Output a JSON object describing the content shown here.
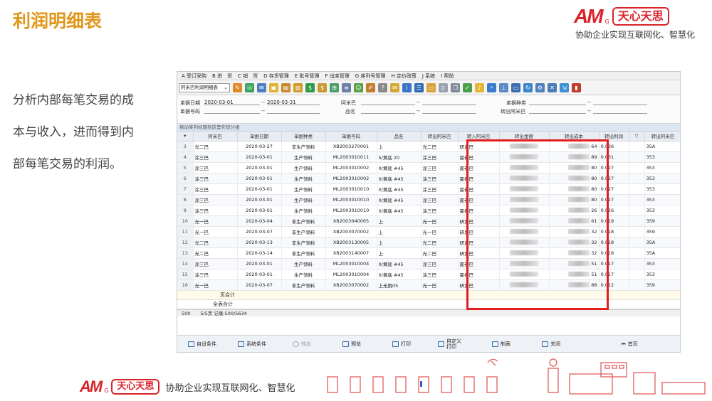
{
  "slide": {
    "title": "利润明细表",
    "description_lines": [
      "分析内部每笔交易的成",
      "本与收入，进而得到内",
      "部每笔交易的利润。"
    ]
  },
  "brand": {
    "logo_text": "AM",
    "logo_sub": "G",
    "name_box": "天心天思",
    "slogan": "协助企业实现互联网化、智慧化",
    "color": "#d8232a"
  },
  "app": {
    "menu": [
      "A 受订采购",
      "B 进　货",
      "C 销　货",
      "D 存货管理",
      "E 批号管理",
      "F 出库管理",
      "G 序列号管理",
      "H 定价政策",
      "J 系统",
      "I 帮助"
    ],
    "report_select": "阿米巴利润明细表",
    "filters": {
      "date_label": "单据日期",
      "date_from": "2020-03-01",
      "date_to": "2020-03-31",
      "amoeba_label": "阿米巴",
      "category_label": "单据种类",
      "doc_no_label": "单据号码",
      "name_label": "品名",
      "out_amoeba_label": "转出阿米巴",
      "range_sep": "--"
    },
    "group_hint": "拖动某列标题到这里实现分组",
    "columns": [
      "",
      "阿米巴",
      "单据日期",
      "单据种类",
      "单据号码",
      "品名",
      "转出阿米巴",
      "转入阿米巴",
      "转出金额",
      "转出成本",
      "转出利润",
      "",
      "转出阿米巴"
    ],
    "rows": [
      {
        "n": "3",
        "amoeba": "光二巴",
        "date": "2020-03-27",
        "kind": "非生产领料",
        "doc": "XB2003270001",
        "name": "上",
        "out": "光二巴",
        "in": "研发巴",
        "cost_tail": "64",
        "profit": "0.036",
        "tail": "35A"
      },
      {
        "n": "4",
        "amoeba": "涂三巴",
        "date": "2020-03-01",
        "kind": "生产领料",
        "doc": "ML2003010011",
        "name": "5/黄底 20",
        "out": "涂三巴",
        "in": "夏卷巴",
        "cost_tail": "89",
        "profit": "0.031",
        "tail": "353"
      },
      {
        "n": "5",
        "amoeba": "涂三巴",
        "date": "2020-03-01",
        "kind": "生产领料",
        "doc": "ML2003010002",
        "name": "0/黄底 #45",
        "out": "涂三巴",
        "in": "夏卷巴",
        "cost_tail": "80",
        "profit": "0.027",
        "tail": "353"
      },
      {
        "n": "6",
        "amoeba": "涂三巴",
        "date": "2020-03-01",
        "kind": "生产领料",
        "doc": "ML2003010002",
        "name": "0/黄底 #45",
        "out": "涂三巴",
        "in": "夏卷巴",
        "cost_tail": "80",
        "profit": "0.027",
        "tail": "353"
      },
      {
        "n": "7",
        "amoeba": "涂三巴",
        "date": "2020-03-01",
        "kind": "生产领料",
        "doc": "ML2003010010",
        "name": "0/黄底 #45",
        "out": "涂三巴",
        "in": "夏卷巴",
        "cost_tail": "80",
        "profit": "0.027",
        "tail": "353"
      },
      {
        "n": "8",
        "amoeba": "涂三巴",
        "date": "2020-03-01",
        "kind": "生产领料",
        "doc": "ML2003010010",
        "name": "0/黄底 #45",
        "out": "涂三巴",
        "in": "夏卷巴",
        "cost_tail": "80",
        "profit": "0.027",
        "tail": "353"
      },
      {
        "n": "9",
        "amoeba": "涂三巴",
        "date": "2020-03-01",
        "kind": "生产领料",
        "doc": "ML2003010010",
        "name": "0/黄底 #45",
        "out": "涂三巴",
        "in": "夏卷巴",
        "cost_tail": "26",
        "profit": "0.026",
        "tail": "353"
      },
      {
        "n": "10",
        "amoeba": "光一巴",
        "date": "2020-03-04",
        "kind": "非生产领料",
        "doc": "XB2003040005",
        "name": "上",
        "out": "光一巴",
        "in": "研发巴",
        "cost_tail": "61",
        "profit": "0.019",
        "tail": "359"
      },
      {
        "n": "11",
        "amoeba": "光一巴",
        "date": "2020-03-07",
        "kind": "非生产领料",
        "doc": "XB2003070002",
        "name": "上",
        "out": "光一巴",
        "in": "研发巴",
        "cost_tail": "32",
        "profit": "0.018",
        "tail": "359"
      },
      {
        "n": "12",
        "amoeba": "光二巴",
        "date": "2020-03-13",
        "kind": "非生产领料",
        "doc": "XB2003130005",
        "name": "上",
        "out": "光二巴",
        "in": "研发巴",
        "cost_tail": "32",
        "profit": "0.018",
        "tail": "35A"
      },
      {
        "n": "13",
        "amoeba": "光二巴",
        "date": "2020-03-14",
        "kind": "非生产领料",
        "doc": "XB2003140007",
        "name": "上",
        "out": "光二巴",
        "in": "研发巴",
        "cost_tail": "32",
        "profit": "0.018",
        "tail": "35A"
      },
      {
        "n": "14",
        "amoeba": "涂三巴",
        "date": "2020-03-01",
        "kind": "生产领料",
        "doc": "ML2003010004",
        "name": "0/黄底 #45",
        "out": "涂三巴",
        "in": "夏卷巴",
        "cost_tail": "51",
        "profit": "0.017",
        "tail": "353"
      },
      {
        "n": "15",
        "amoeba": "涂三巴",
        "date": "2020-03-01",
        "kind": "生产领料",
        "doc": "ML2003010004",
        "name": "0/黄底 #45",
        "out": "涂三巴",
        "in": "夏卷巴",
        "cost_tail": "51",
        "profit": "0.017",
        "tail": "353"
      },
      {
        "n": "16",
        "amoeba": "光一巴",
        "date": "2020-03-07",
        "kind": "非生产领料",
        "doc": "XB2003070002",
        "name": "上无脱05",
        "out": "光一巴",
        "in": "研发巴",
        "cost_tail": "88",
        "profit": "0.012",
        "tail": "359"
      }
    ],
    "page_total_label": "页合计",
    "grand_total_label": "全表合计",
    "status": {
      "left": "500",
      "pages": "5/5页 记录:500/5634"
    },
    "bottom_buttons": [
      "自设条件",
      "系统条件",
      "转出",
      "预览",
      "打印",
      "自定义打印",
      "制表",
      "关闭",
      "首页"
    ],
    "highlight_color": "#e01e1e"
  }
}
